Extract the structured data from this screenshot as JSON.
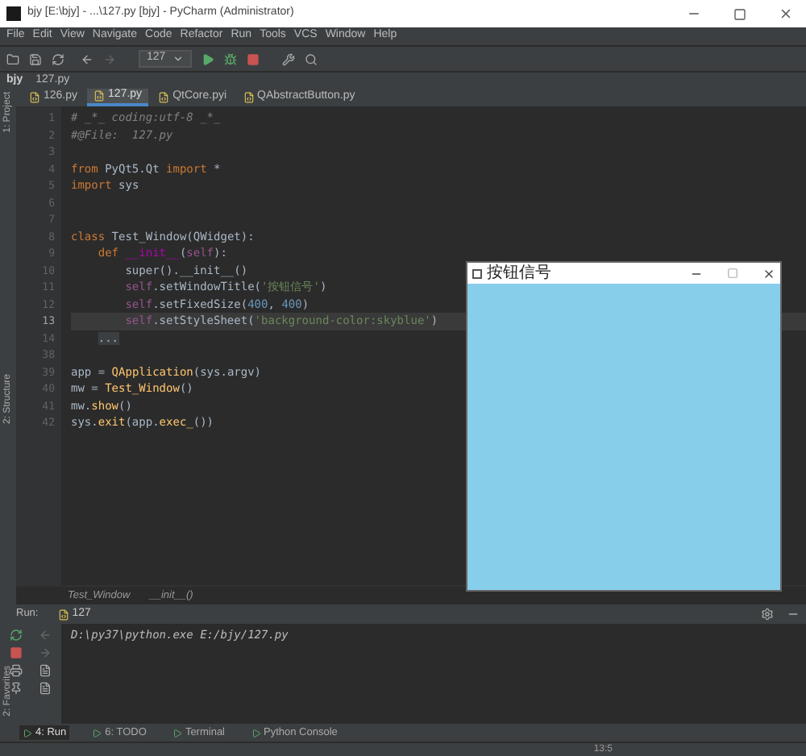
{
  "window": {
    "title": "bjy [E:\\bjy] - ...\\127.py [bjy] - PyCharm (Administrator)"
  },
  "menu": [
    "File",
    "Edit",
    "View",
    "Navigate",
    "Code",
    "Refactor",
    "Run",
    "Tools",
    "VCS",
    "Window",
    "Help"
  ],
  "toolbar": {
    "run_config": "127"
  },
  "breadcrumb": [
    "bjy",
    "127.py"
  ],
  "tabs": [
    {
      "label": "126.py",
      "selected": false
    },
    {
      "label": "127.py",
      "selected": true
    },
    {
      "label": "QtCore.pyi",
      "selected": false
    },
    {
      "label": "QAbstractButton.py",
      "selected": false
    }
  ],
  "side_tabs": [
    "1: Project",
    "2: Structure",
    "2: Favorites"
  ],
  "editor": {
    "lines": [
      {
        "number": "1",
        "current": false,
        "segments": [
          {
            "kind": "comment",
            "text": "# _*_ coding:utf-8 _*_"
          }
        ]
      },
      {
        "number": "2",
        "current": false,
        "segments": [
          {
            "kind": "comment",
            "text": "#@File:  127.py"
          }
        ]
      },
      {
        "number": "3",
        "current": false
      },
      {
        "number": "4",
        "current": false,
        "segments": [
          {
            "kind": "keyword",
            "text": "from "
          },
          {
            "kind": "plain",
            "text": "PyQt5.Qt "
          },
          {
            "kind": "keyword",
            "text": "import "
          },
          {
            "kind": "plain",
            "text": "*"
          }
        ]
      },
      {
        "number": "5",
        "current": false,
        "segments": [
          {
            "kind": "keyword",
            "text": "import "
          },
          {
            "kind": "plain",
            "text": "sys"
          }
        ]
      },
      {
        "number": "6",
        "current": false
      },
      {
        "number": "7",
        "current": false
      },
      {
        "number": "8",
        "current": false,
        "segments": [
          {
            "kind": "keyword",
            "text": "class "
          },
          {
            "kind": "plain",
            "text": "Test_Window(QWidget):"
          }
        ]
      },
      {
        "number": "9",
        "current": false,
        "segments": [
          {
            "kind": "keyword",
            "text": "    def "
          },
          {
            "kind": "magic",
            "text": "__init__"
          },
          {
            "kind": "plain",
            "text": "("
          },
          {
            "kind": "self",
            "text": "self"
          },
          {
            "kind": "plain",
            "text": "):"
          }
        ]
      },
      {
        "number": "10",
        "current": false,
        "segments": [
          {
            "kind": "plain",
            "text": "        super().__init__()"
          }
        ]
      },
      {
        "number": "11",
        "current": false,
        "segments": [
          {
            "kind": "self",
            "text": "        self"
          },
          {
            "kind": "plain",
            "text": ".setWindowTitle("
          },
          {
            "kind": "string",
            "text": "'按钮信号'"
          },
          {
            "kind": "plain",
            "text": ")"
          }
        ]
      },
      {
        "number": "12",
        "current": false,
        "segments": [
          {
            "kind": "self",
            "text": "        self"
          },
          {
            "kind": "plain",
            "text": ".setFixedSize("
          },
          {
            "kind": "number",
            "text": "400"
          },
          {
            "kind": "plain",
            "text": ", "
          },
          {
            "kind": "number",
            "text": "400"
          },
          {
            "kind": "plain",
            "text": ")"
          }
        ]
      },
      {
        "number": "13",
        "current": true,
        "segments": [
          {
            "kind": "self",
            "text": "        self"
          },
          {
            "kind": "plain",
            "text": ".setStyleSheet("
          },
          {
            "kind": "string",
            "text": "'background-color:skyblue'"
          },
          {
            "kind": "plain",
            "text": ")"
          }
        ]
      },
      {
        "number": "14",
        "current": false,
        "segments": [
          {
            "kind": "fold",
            "text": "    ..."
          }
        ]
      },
      {
        "number": "38",
        "current": false
      },
      {
        "number": "39",
        "current": false,
        "segments": [
          {
            "kind": "plain",
            "text": "app = "
          },
          {
            "kind": "call",
            "text": "QApplication"
          },
          {
            "kind": "plain",
            "text": "(sys.argv)"
          }
        ]
      },
      {
        "number": "40",
        "current": false,
        "segments": [
          {
            "kind": "plain",
            "text": "mw = "
          },
          {
            "kind": "call",
            "text": "Test_Window"
          },
          {
            "kind": "plain",
            "text": "()"
          }
        ]
      },
      {
        "number": "41",
        "current": false,
        "segments": [
          {
            "kind": "plain",
            "text": "mw."
          },
          {
            "kind": "call",
            "text": "show"
          },
          {
            "kind": "plain",
            "text": "()"
          }
        ]
      },
      {
        "number": "42",
        "current": false,
        "segments": [
          {
            "kind": "plain",
            "text": "sys."
          },
          {
            "kind": "call",
            "text": "exit"
          },
          {
            "kind": "plain",
            "text": "(app."
          },
          {
            "kind": "call",
            "text": "exec_"
          },
          {
            "kind": "plain",
            "text": "())"
          }
        ]
      }
    ],
    "breadcrumb": [
      "Test_Window",
      "__init__()"
    ]
  },
  "qt_window": {
    "title": "按钮信号"
  },
  "run_panel": {
    "label": "Run:",
    "tab": "127",
    "output": "D:\\py37\\python.exe E:/bjy/127.py"
  },
  "tool_tabs": [
    {
      "label": "4: Run",
      "selected": true
    },
    {
      "label": "6: TODO",
      "selected": false
    },
    {
      "label": "Terminal",
      "selected": false
    },
    {
      "label": "Python Console",
      "selected": false
    }
  ],
  "status_bar": {
    "position": "13:5"
  }
}
